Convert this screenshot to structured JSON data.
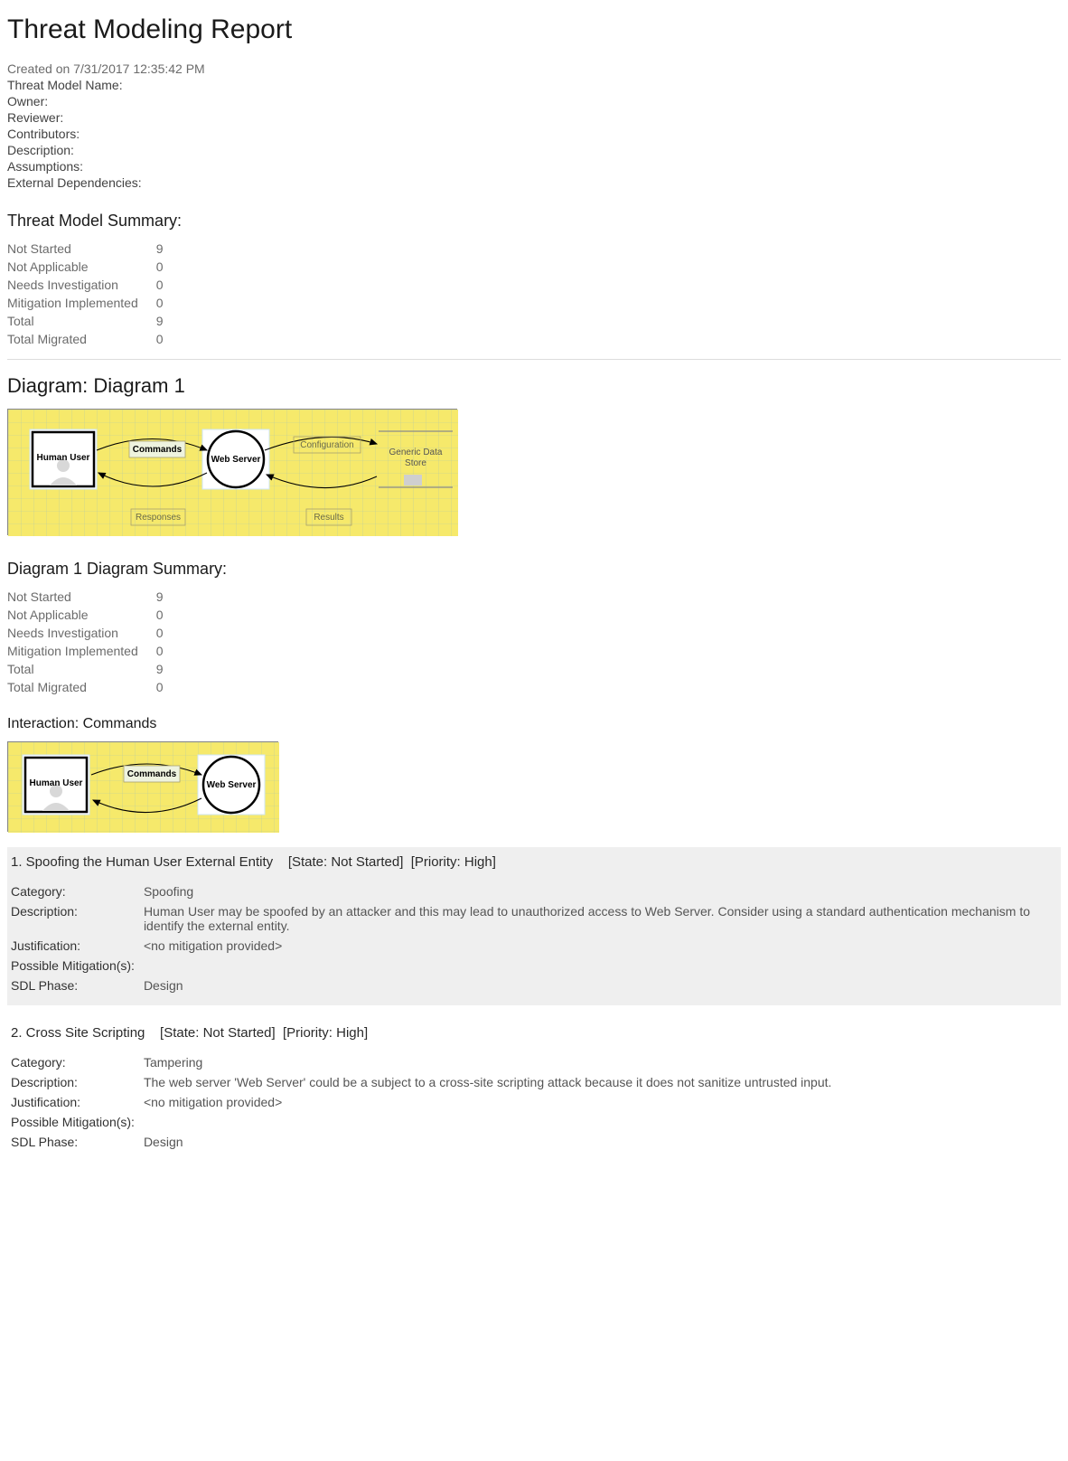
{
  "title": "Threat Modeling Report",
  "created": "Created on 7/31/2017 12:35:42 PM",
  "meta": {
    "model_name_lbl": "Threat Model Name:",
    "owner_lbl": "Owner:",
    "reviewer_lbl": "Reviewer:",
    "contributors_lbl": "Contributors:",
    "description_lbl": "Description:",
    "assumptions_lbl": "Assumptions:",
    "ext_dep_lbl": "External Dependencies:"
  },
  "summary_heading": "Threat Model Summary:",
  "summary": [
    {
      "label": "Not Started",
      "value": "9"
    },
    {
      "label": "Not Applicable",
      "value": "0"
    },
    {
      "label": "Needs Investigation",
      "value": "0"
    },
    {
      "label": "Mitigation Implemented",
      "value": "0"
    },
    {
      "label": "Total",
      "value": "9"
    },
    {
      "label": "Total Migrated",
      "value": "0"
    }
  ],
  "diagram_title": "Diagram: Diagram 1",
  "diagram_nodes": {
    "human_user": "Human User",
    "web_server": "Web Server",
    "data_store": "Generic Data Store",
    "commands": "Commands",
    "responses": "Responses",
    "configuration": "Configuration",
    "results": "Results"
  },
  "diag_summary_heading": "Diagram 1 Diagram Summary:",
  "diag_summary": [
    {
      "label": "Not Started",
      "value": "9"
    },
    {
      "label": "Not Applicable",
      "value": "0"
    },
    {
      "label": "Needs Investigation",
      "value": "0"
    },
    {
      "label": "Mitigation Implemented",
      "value": "0"
    },
    {
      "label": "Total",
      "value": "9"
    },
    {
      "label": "Total Migrated",
      "value": "0"
    }
  ],
  "interaction_heading": "Interaction: Commands",
  "threats": [
    {
      "header": "1. Spoofing the Human User External Entity    [State: Not Started]  [Priority: High]",
      "category_lbl": "Category:",
      "category": "Spoofing",
      "description_lbl": "Description:",
      "description": "Human User may be spoofed by an attacker and this may lead to unauthorized access to Web Server. Consider using a standard authentication mechanism to identify the external entity.",
      "justification_lbl": "Justification:",
      "justification": "<no mitigation provided>",
      "mitigations_lbl": "Possible Mitigation(s):",
      "mitigations": "",
      "sdl_lbl": "SDL Phase:",
      "sdl": "Design",
      "shaded": true
    },
    {
      "header": "2. Cross Site Scripting    [State: Not Started]  [Priority: High]",
      "category_lbl": "Category:",
      "category": "Tampering",
      "description_lbl": "Description:",
      "description": "The web server 'Web Server' could be a subject to a cross-site scripting attack because it does not sanitize untrusted input.",
      "justification_lbl": "Justification:",
      "justification": "<no mitigation provided>",
      "mitigations_lbl": "Possible Mitigation(s):",
      "mitigations": "",
      "sdl_lbl": "SDL Phase:",
      "sdl": "Design",
      "shaded": false
    }
  ]
}
